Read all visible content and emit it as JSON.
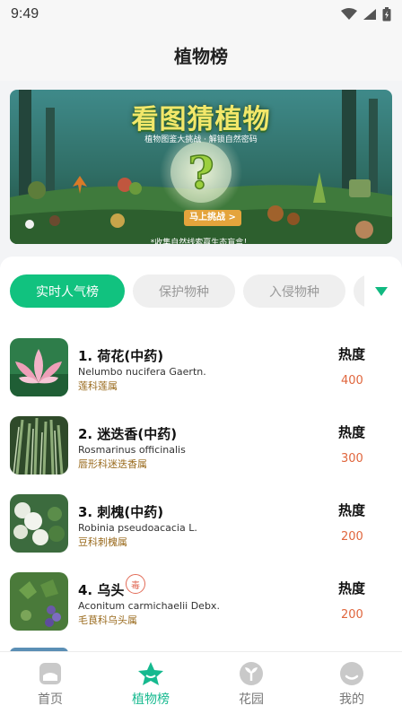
{
  "status": {
    "time": "9:49"
  },
  "header": {
    "title": "植物榜"
  },
  "banner": {
    "title": "看图猜植物",
    "subtitle": "植物图鉴大挑战 · 解锁自然密码",
    "cta": "马上挑战 >",
    "note": "*收集自然线索赢生态盲盒！"
  },
  "tabs": [
    {
      "label": "实时人气榜",
      "active": true
    },
    {
      "label": "保护物种",
      "active": false
    },
    {
      "label": "入侵物种",
      "active": false
    }
  ],
  "list_header": {
    "heat_label": "热度"
  },
  "plants": [
    {
      "name": "1. 荷花(中药)",
      "latin": "Nelumbo nucifera Gaertn.",
      "family": "莲科莲属",
      "heat": "400"
    },
    {
      "name": "2. 迷迭香(中药)",
      "latin": "Rosmarinus officinalis",
      "family": "唇形科迷迭香属",
      "heat": "300"
    },
    {
      "name": "3. 刺槐(中药)",
      "latin": "Robinia pseudoacacia L.",
      "family": "豆科刺槐属",
      "heat": "200"
    },
    {
      "name": "4. 乌头",
      "latin": "Aconitum carmichaelii Debx.",
      "family": "毛茛科乌头属",
      "heat": "200",
      "badge": "毒"
    }
  ],
  "nav": [
    {
      "label": "首页",
      "icon": "home-icon",
      "active": false
    },
    {
      "label": "植物榜",
      "icon": "star-icon",
      "active": true
    },
    {
      "label": "花园",
      "icon": "sprout-icon",
      "active": false
    },
    {
      "label": "我的",
      "icon": "profile-icon",
      "active": false
    }
  ],
  "colors": {
    "accent": "#11c27f",
    "heat": "#e0663d",
    "family": "#9a6b1e"
  }
}
